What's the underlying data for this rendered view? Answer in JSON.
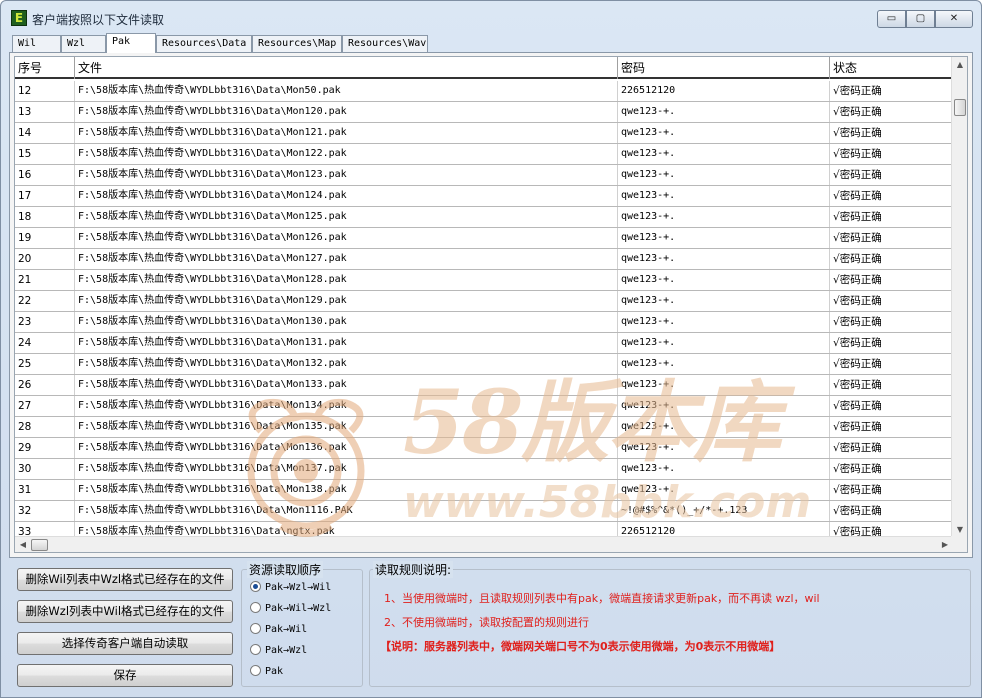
{
  "window": {
    "title": "客户端按照以下文件读取",
    "icon_letter": "E",
    "controls": {
      "minimize": "▭",
      "maximize": "▢",
      "close": "✕"
    }
  },
  "tabs": [
    {
      "label": "Wil"
    },
    {
      "label": "Wzl"
    },
    {
      "label": "Pak",
      "active": true
    },
    {
      "label": "Resources\\Data"
    },
    {
      "label": "Resources\\Map"
    },
    {
      "label": "Resources\\Wav"
    }
  ],
  "grid": {
    "headers": [
      "序号",
      "文件",
      "密码",
      "状态"
    ],
    "rows": [
      {
        "no": "12",
        "file": "F:\\58版本库\\热血传奇\\WYDLbbt316\\Data\\Mon50.pak",
        "password": "226512120",
        "status": "√密码正确"
      },
      {
        "no": "13",
        "file": "F:\\58版本库\\热血传奇\\WYDLbbt316\\Data\\Mon120.pak",
        "password": "qwe123-+.",
        "status": "√密码正确"
      },
      {
        "no": "14",
        "file": "F:\\58版本库\\热血传奇\\WYDLbbt316\\Data\\Mon121.pak",
        "password": "qwe123-+.",
        "status": "√密码正确"
      },
      {
        "no": "15",
        "file": "F:\\58版本库\\热血传奇\\WYDLbbt316\\Data\\Mon122.pak",
        "password": "qwe123-+.",
        "status": "√密码正确"
      },
      {
        "no": "16",
        "file": "F:\\58版本库\\热血传奇\\WYDLbbt316\\Data\\Mon123.pak",
        "password": "qwe123-+.",
        "status": "√密码正确"
      },
      {
        "no": "17",
        "file": "F:\\58版本库\\热血传奇\\WYDLbbt316\\Data\\Mon124.pak",
        "password": "qwe123-+.",
        "status": "√密码正确"
      },
      {
        "no": "18",
        "file": "F:\\58版本库\\热血传奇\\WYDLbbt316\\Data\\Mon125.pak",
        "password": "qwe123-+.",
        "status": "√密码正确"
      },
      {
        "no": "19",
        "file": "F:\\58版本库\\热血传奇\\WYDLbbt316\\Data\\Mon126.pak",
        "password": "qwe123-+.",
        "status": "√密码正确"
      },
      {
        "no": "20",
        "file": "F:\\58版本库\\热血传奇\\WYDLbbt316\\Data\\Mon127.pak",
        "password": "qwe123-+.",
        "status": "√密码正确"
      },
      {
        "no": "21",
        "file": "F:\\58版本库\\热血传奇\\WYDLbbt316\\Data\\Mon128.pak",
        "password": "qwe123-+.",
        "status": "√密码正确"
      },
      {
        "no": "22",
        "file": "F:\\58版本库\\热血传奇\\WYDLbbt316\\Data\\Mon129.pak",
        "password": "qwe123-+.",
        "status": "√密码正确"
      },
      {
        "no": "23",
        "file": "F:\\58版本库\\热血传奇\\WYDLbbt316\\Data\\Mon130.pak",
        "password": "qwe123-+.",
        "status": "√密码正确"
      },
      {
        "no": "24",
        "file": "F:\\58版本库\\热血传奇\\WYDLbbt316\\Data\\Mon131.pak",
        "password": "qwe123-+.",
        "status": "√密码正确"
      },
      {
        "no": "25",
        "file": "F:\\58版本库\\热血传奇\\WYDLbbt316\\Data\\Mon132.pak",
        "password": "qwe123-+.",
        "status": "√密码正确"
      },
      {
        "no": "26",
        "file": "F:\\58版本库\\热血传奇\\WYDLbbt316\\Data\\Mon133.pak",
        "password": "qwe123-+.",
        "status": "√密码正确"
      },
      {
        "no": "27",
        "file": "F:\\58版本库\\热血传奇\\WYDLbbt316\\Data\\Mon134.pak",
        "password": "qwe123-+.",
        "status": "√密码正确"
      },
      {
        "no": "28",
        "file": "F:\\58版本库\\热血传奇\\WYDLbbt316\\Data\\Mon135.pak",
        "password": "qwe123-+.",
        "status": "√密码正确"
      },
      {
        "no": "29",
        "file": "F:\\58版本库\\热血传奇\\WYDLbbt316\\Data\\Mon136.pak",
        "password": "qwe123-+.",
        "status": "√密码正确"
      },
      {
        "no": "30",
        "file": "F:\\58版本库\\热血传奇\\WYDLbbt316\\Data\\Mon137.pak",
        "password": "qwe123-+.",
        "status": "√密码正确"
      },
      {
        "no": "31",
        "file": "F:\\58版本库\\热血传奇\\WYDLbbt316\\Data\\Mon138.pak",
        "password": "qwe123-+.",
        "status": "√密码正确"
      },
      {
        "no": "32",
        "file": "F:\\58版本库\\热血传奇\\WYDLbbt316\\Data\\Mon1116.PAK",
        "password": "~!@#$%^&*()_+/*-+.123",
        "status": "√密码正确"
      },
      {
        "no": "33",
        "file": "F:\\58版本库\\热血传奇\\WYDLbbt316\\Data\\ngtx.pak",
        "password": "226512120",
        "status": "√密码正确"
      }
    ]
  },
  "actions": {
    "delete_wil": "删除Wil列表中Wzl格式已经存在的文件",
    "delete_wzl": "删除Wzl列表中Wil格式已经存在的文件",
    "choose_client": "选择传奇客户端自动读取",
    "save": "保存"
  },
  "read_order": {
    "title": "资源读取顺序",
    "options": [
      {
        "label": "Pak→Wzl→Wil",
        "checked": true
      },
      {
        "label": "Pak→Wil→Wzl",
        "checked": false
      },
      {
        "label": "Pak→Wil",
        "checked": false
      },
      {
        "label": "Pak→Wzl",
        "checked": false
      },
      {
        "label": "Pak",
        "checked": false
      }
    ]
  },
  "rules": {
    "title": "读取规则说明:",
    "line1": "1、当使用微端时，且读取规则列表中有pak，微端直接请求更新pak，而不再读 wzl，wil",
    "line2": "2、不使用微端时，读取按配置的规则进行",
    "note": "【说明：服务器列表中，微端网关端口号不为0表示使用微端，为0表示不用微端】"
  },
  "watermark": {
    "brand": "58版本库",
    "url": "www.58bbk.com"
  },
  "colors": {
    "rule_text": "#e0201c",
    "window_bg": "#d6e2ef"
  }
}
